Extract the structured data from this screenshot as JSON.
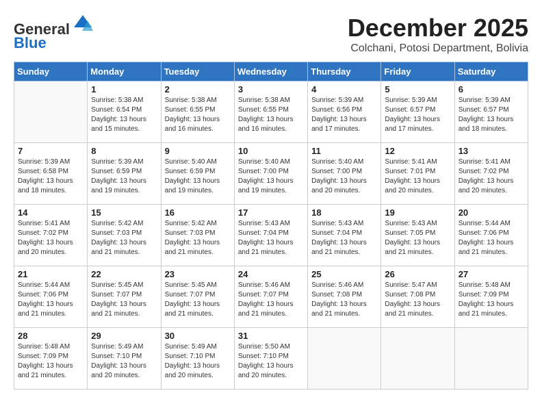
{
  "header": {
    "logo_line1": "General",
    "logo_line2": "Blue",
    "month": "December 2025",
    "location": "Colchani, Potosi Department, Bolivia"
  },
  "weekdays": [
    "Sunday",
    "Monday",
    "Tuesday",
    "Wednesday",
    "Thursday",
    "Friday",
    "Saturday"
  ],
  "weeks": [
    [
      {
        "day": "",
        "info": ""
      },
      {
        "day": "1",
        "info": "Sunrise: 5:38 AM\nSunset: 6:54 PM\nDaylight: 13 hours\nand 15 minutes."
      },
      {
        "day": "2",
        "info": "Sunrise: 5:38 AM\nSunset: 6:55 PM\nDaylight: 13 hours\nand 16 minutes."
      },
      {
        "day": "3",
        "info": "Sunrise: 5:38 AM\nSunset: 6:55 PM\nDaylight: 13 hours\nand 16 minutes."
      },
      {
        "day": "4",
        "info": "Sunrise: 5:39 AM\nSunset: 6:56 PM\nDaylight: 13 hours\nand 17 minutes."
      },
      {
        "day": "5",
        "info": "Sunrise: 5:39 AM\nSunset: 6:57 PM\nDaylight: 13 hours\nand 17 minutes."
      },
      {
        "day": "6",
        "info": "Sunrise: 5:39 AM\nSunset: 6:57 PM\nDaylight: 13 hours\nand 18 minutes."
      }
    ],
    [
      {
        "day": "7",
        "info": "Sunrise: 5:39 AM\nSunset: 6:58 PM\nDaylight: 13 hours\nand 18 minutes."
      },
      {
        "day": "8",
        "info": "Sunrise: 5:39 AM\nSunset: 6:59 PM\nDaylight: 13 hours\nand 19 minutes."
      },
      {
        "day": "9",
        "info": "Sunrise: 5:40 AM\nSunset: 6:59 PM\nDaylight: 13 hours\nand 19 minutes."
      },
      {
        "day": "10",
        "info": "Sunrise: 5:40 AM\nSunset: 7:00 PM\nDaylight: 13 hours\nand 19 minutes."
      },
      {
        "day": "11",
        "info": "Sunrise: 5:40 AM\nSunset: 7:00 PM\nDaylight: 13 hours\nand 20 minutes."
      },
      {
        "day": "12",
        "info": "Sunrise: 5:41 AM\nSunset: 7:01 PM\nDaylight: 13 hours\nand 20 minutes."
      },
      {
        "day": "13",
        "info": "Sunrise: 5:41 AM\nSunset: 7:02 PM\nDaylight: 13 hours\nand 20 minutes."
      }
    ],
    [
      {
        "day": "14",
        "info": "Sunrise: 5:41 AM\nSunset: 7:02 PM\nDaylight: 13 hours\nand 20 minutes."
      },
      {
        "day": "15",
        "info": "Sunrise: 5:42 AM\nSunset: 7:03 PM\nDaylight: 13 hours\nand 21 minutes."
      },
      {
        "day": "16",
        "info": "Sunrise: 5:42 AM\nSunset: 7:03 PM\nDaylight: 13 hours\nand 21 minutes."
      },
      {
        "day": "17",
        "info": "Sunrise: 5:43 AM\nSunset: 7:04 PM\nDaylight: 13 hours\nand 21 minutes."
      },
      {
        "day": "18",
        "info": "Sunrise: 5:43 AM\nSunset: 7:04 PM\nDaylight: 13 hours\nand 21 minutes."
      },
      {
        "day": "19",
        "info": "Sunrise: 5:43 AM\nSunset: 7:05 PM\nDaylight: 13 hours\nand 21 minutes."
      },
      {
        "day": "20",
        "info": "Sunrise: 5:44 AM\nSunset: 7:06 PM\nDaylight: 13 hours\nand 21 minutes."
      }
    ],
    [
      {
        "day": "21",
        "info": "Sunrise: 5:44 AM\nSunset: 7:06 PM\nDaylight: 13 hours\nand 21 minutes."
      },
      {
        "day": "22",
        "info": "Sunrise: 5:45 AM\nSunset: 7:07 PM\nDaylight: 13 hours\nand 21 minutes."
      },
      {
        "day": "23",
        "info": "Sunrise: 5:45 AM\nSunset: 7:07 PM\nDaylight: 13 hours\nand 21 minutes."
      },
      {
        "day": "24",
        "info": "Sunrise: 5:46 AM\nSunset: 7:07 PM\nDaylight: 13 hours\nand 21 minutes."
      },
      {
        "day": "25",
        "info": "Sunrise: 5:46 AM\nSunset: 7:08 PM\nDaylight: 13 hours\nand 21 minutes."
      },
      {
        "day": "26",
        "info": "Sunrise: 5:47 AM\nSunset: 7:08 PM\nDaylight: 13 hours\nand 21 minutes."
      },
      {
        "day": "27",
        "info": "Sunrise: 5:48 AM\nSunset: 7:09 PM\nDaylight: 13 hours\nand 21 minutes."
      }
    ],
    [
      {
        "day": "28",
        "info": "Sunrise: 5:48 AM\nSunset: 7:09 PM\nDaylight: 13 hours\nand 21 minutes."
      },
      {
        "day": "29",
        "info": "Sunrise: 5:49 AM\nSunset: 7:10 PM\nDaylight: 13 hours\nand 20 minutes."
      },
      {
        "day": "30",
        "info": "Sunrise: 5:49 AM\nSunset: 7:10 PM\nDaylight: 13 hours\nand 20 minutes."
      },
      {
        "day": "31",
        "info": "Sunrise: 5:50 AM\nSunset: 7:10 PM\nDaylight: 13 hours\nand 20 minutes."
      },
      {
        "day": "",
        "info": ""
      },
      {
        "day": "",
        "info": ""
      },
      {
        "day": "",
        "info": ""
      }
    ]
  ]
}
